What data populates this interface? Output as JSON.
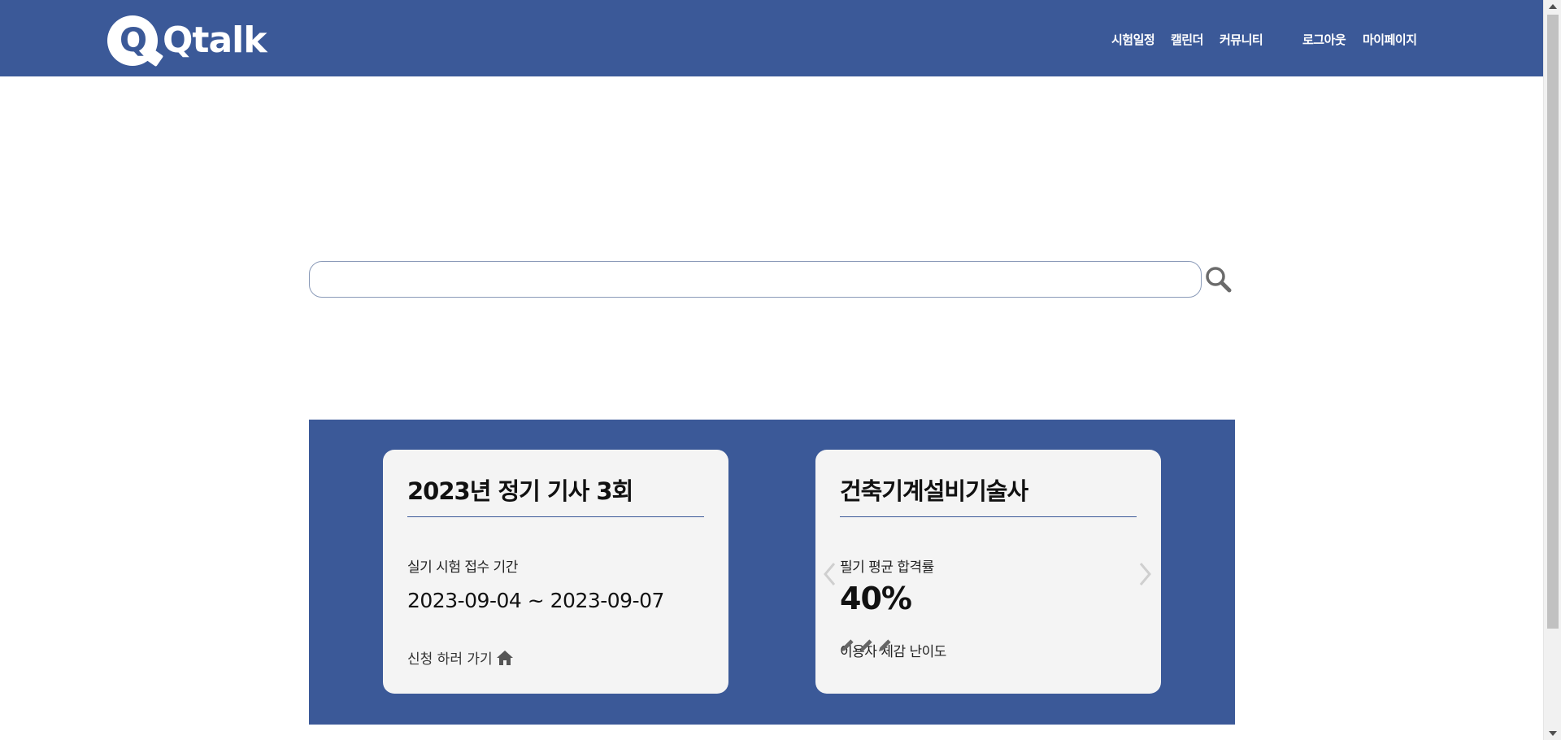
{
  "header": {
    "logo_text": "Qtalk",
    "logo_letter": "Q",
    "nav": {
      "exam_schedule": "시험일정",
      "calendar": "캘린더",
      "community": "커뮤니티",
      "logout": "로그아웃",
      "mypage": "마이페이지"
    }
  },
  "search": {
    "value": "",
    "icon": "search-icon"
  },
  "cards": [
    {
      "title": "2023년 정기 기사 3회",
      "label": "실기 시험 접수 기간",
      "value": "2023-09-04 ~ 2023-09-07",
      "link_label": "신청 하러 가기",
      "link_icon": "home-icon"
    },
    {
      "title": "건축기계설비기술사",
      "pass_label": "필기 평균 합격률",
      "pass_rate": "40%",
      "difficulty_label": "이용자 체감 난이도",
      "difficulty_level": 3,
      "difficulty_icon": "pencil-icon"
    }
  ],
  "colors": {
    "brand": "#3b5998",
    "card_bg": "#f4f4f4"
  }
}
